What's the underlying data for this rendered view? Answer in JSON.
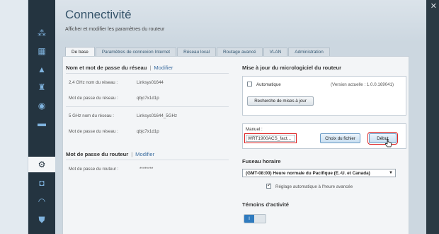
{
  "window": {
    "close_glyph": "✕"
  },
  "sidebar": {
    "icons": [
      {
        "name": "network-map-icon",
        "glyph": "⁂",
        "color": "#7fb3de"
      },
      {
        "name": "device-list-icon",
        "glyph": "▦",
        "color": "#7fb3de"
      },
      {
        "name": "troubleshooting-icon",
        "glyph": "▲",
        "color": "#7fb3de"
      },
      {
        "name": "parental-controls-icon",
        "glyph": "♜",
        "color": "#7fb3de"
      },
      {
        "name": "media-prioritization-icon",
        "glyph": "◉",
        "color": "#7fb3de"
      },
      {
        "name": "speed-test-icon",
        "glyph": "▬",
        "color": "#7fb3de"
      },
      {
        "name": "connectivity-icon",
        "glyph": "⚙",
        "color": "#243440"
      },
      {
        "name": "external-storage-icon",
        "glyph": "◘",
        "color": "#7fb3de"
      },
      {
        "name": "wireless-icon",
        "glyph": "◠",
        "color": "#7fb3de"
      },
      {
        "name": "security-icon",
        "glyph": "⛊",
        "color": "#7fb3de"
      }
    ]
  },
  "header": {
    "title": "Connectivité",
    "subtitle": "Afficher et modifier les paramètres du routeur"
  },
  "tabs": [
    {
      "label": "De base"
    },
    {
      "label": "Paramètres de connexion Internet"
    },
    {
      "label": "Réseau local"
    },
    {
      "label": "Routage avancé"
    },
    {
      "label": "VLAN"
    },
    {
      "label": "Administration"
    }
  ],
  "network": {
    "heading": "Nom et mot de passe du réseau",
    "separator": "|",
    "edit_label": "Modifier",
    "band24_name_label": "2,4 GHz nom du réseau :",
    "band24_name_value": "Linksys01644",
    "band24_pass_label": "Mot de passe du réseau :",
    "band24_pass_value": "qbjc7x1d1p",
    "band5_name_label": "5 GHz nom du réseau :",
    "band5_name_value": "Linksys01644_5GHz",
    "band5_pass_label": "Mot de passe du réseau :",
    "band5_pass_value": "qbjc7x1d1p"
  },
  "router_password": {
    "heading": "Mot de passe du routeur",
    "separator": "|",
    "edit_label": "Modifier",
    "pass_label": "Mot de passe du routeur :",
    "pass_value": "********"
  },
  "firmware": {
    "heading": "Mise à jour du micrologiciel du routeur",
    "auto_label": "Automatique",
    "version_text": "(Version actuelle : 1.0.0.169041)",
    "check_button": "Recherche de mises à jour",
    "manual_label": "Manuel :",
    "file_value": "WRT1900ACS_fact...",
    "choose_file_button": "Choix du fichier",
    "start_button": "Début"
  },
  "timezone": {
    "heading": "Fuseau horaire",
    "selected": "(GMT-08:00) Heure normale du Pacifique (E.-U. et Canada)",
    "dst_label": "Réglage automatique à l'heure avancée"
  },
  "leds": {
    "heading": "Témoins d'activité",
    "toggle_value": "I"
  },
  "colors": {
    "accent": "#2f7bbf",
    "highlight": "#dd2222",
    "sidebar": "#243440"
  }
}
